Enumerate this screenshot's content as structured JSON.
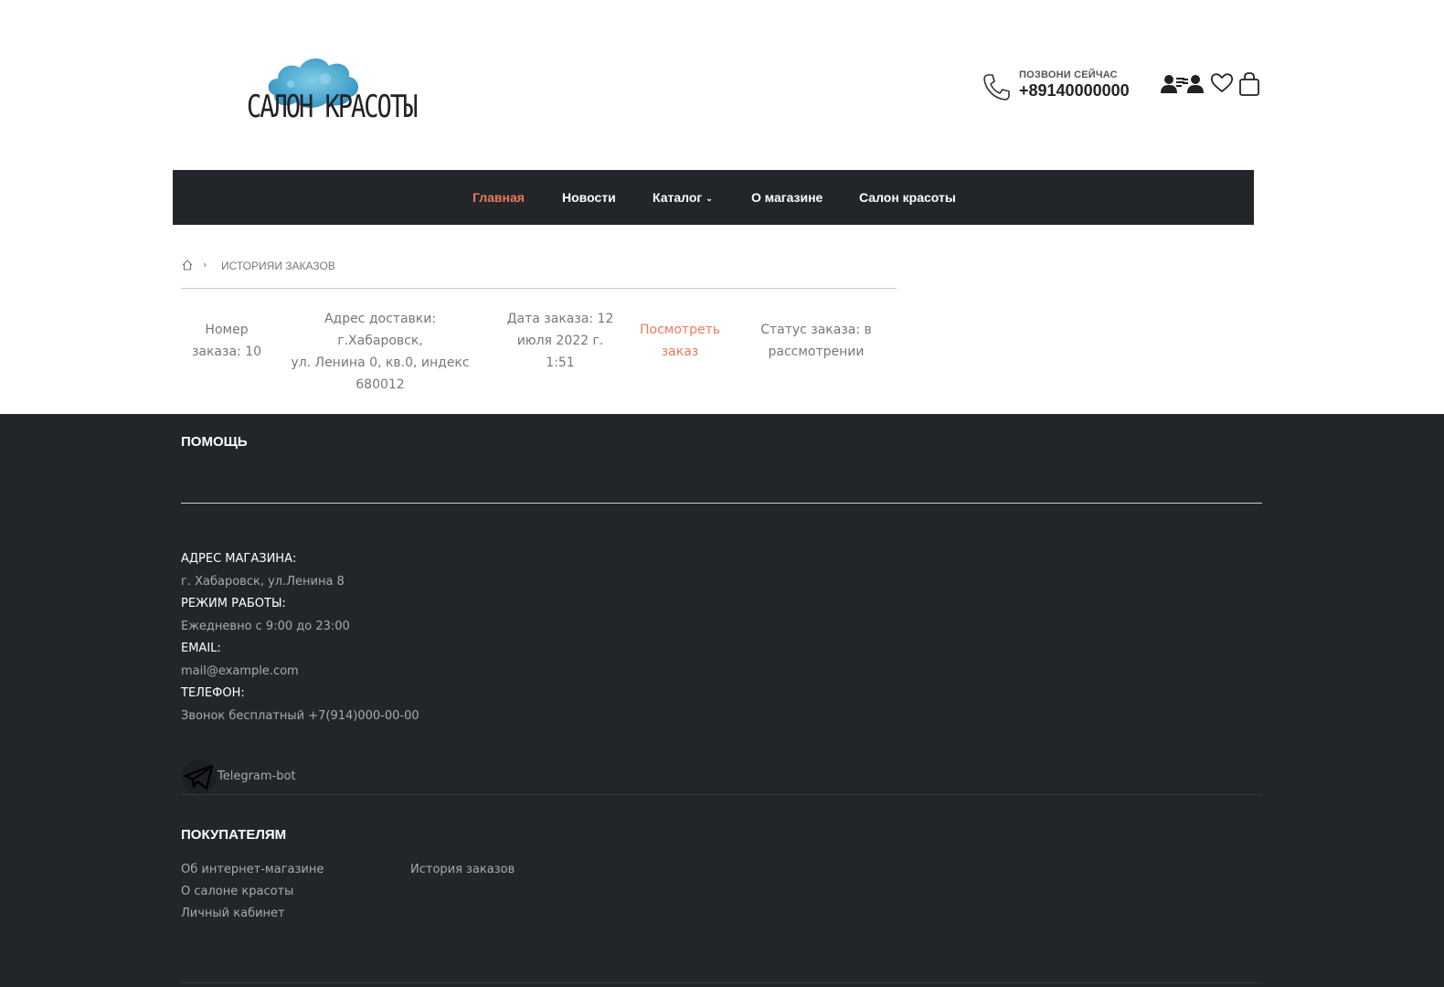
{
  "header": {
    "logo_text": "САЛОН КРАСОТЫ",
    "call_caption": "ПОЗВОНИ СЕЙЧАС",
    "call_number": "+89140000000"
  },
  "nav": {
    "items": [
      {
        "label": "Главная",
        "active": true
      },
      {
        "label": "Новости"
      },
      {
        "label": "Каталог",
        "has_dropdown": true
      },
      {
        "label": "О магазине"
      },
      {
        "label": "Салон красоты"
      }
    ]
  },
  "breadcrumb": {
    "current": "ИСТОРИЯИ ЗАКАЗОВ"
  },
  "order": {
    "number_line1": "Номер",
    "number_line2": "заказа: 10",
    "address_line1": "Адрес доставки: г.Хабаровск,",
    "address_line2": "ул. Ленина 0, кв.0, индекс",
    "address_line3": "680012",
    "date_line1": "Дата заказа: 12",
    "date_line2": "июля 2022 г.",
    "date_line3": "1:51",
    "view_line1": "Посмотреть",
    "view_line2": "заказ",
    "status_line1": "Статус заказа: в",
    "status_line2": "рассмотрении"
  },
  "footer": {
    "help_title": "ПОМОЩЬ",
    "address_label": "АДРЕС МАГАЗИНА:",
    "address_value": "г. Хабаровск, ул.Ленина 8",
    "hours_label": "РЕЖИМ РАБОТЫ:",
    "hours_value": "Ежедневно с 9:00 до 23:00",
    "email_label": "EMAIL:",
    "email_value": "mail@example.com",
    "phone_label": "ТЕЛЕФОН:",
    "phone_value": "Звонок бесплатный +7(914)000-00-00",
    "telegram_label": "Telegram-bot",
    "buyers_title": "ПОКУПАТЕЛЯМ",
    "links": {
      "about_shop": "Об интернет-магазине",
      "about_salon": "О салоне красоты",
      "account": "Личный кабинет",
      "order_history": "История заказов"
    }
  },
  "colors": {
    "accent": "#ec7a5c",
    "dark": "#22262b",
    "logo_cloud": "#4aa8cf"
  }
}
